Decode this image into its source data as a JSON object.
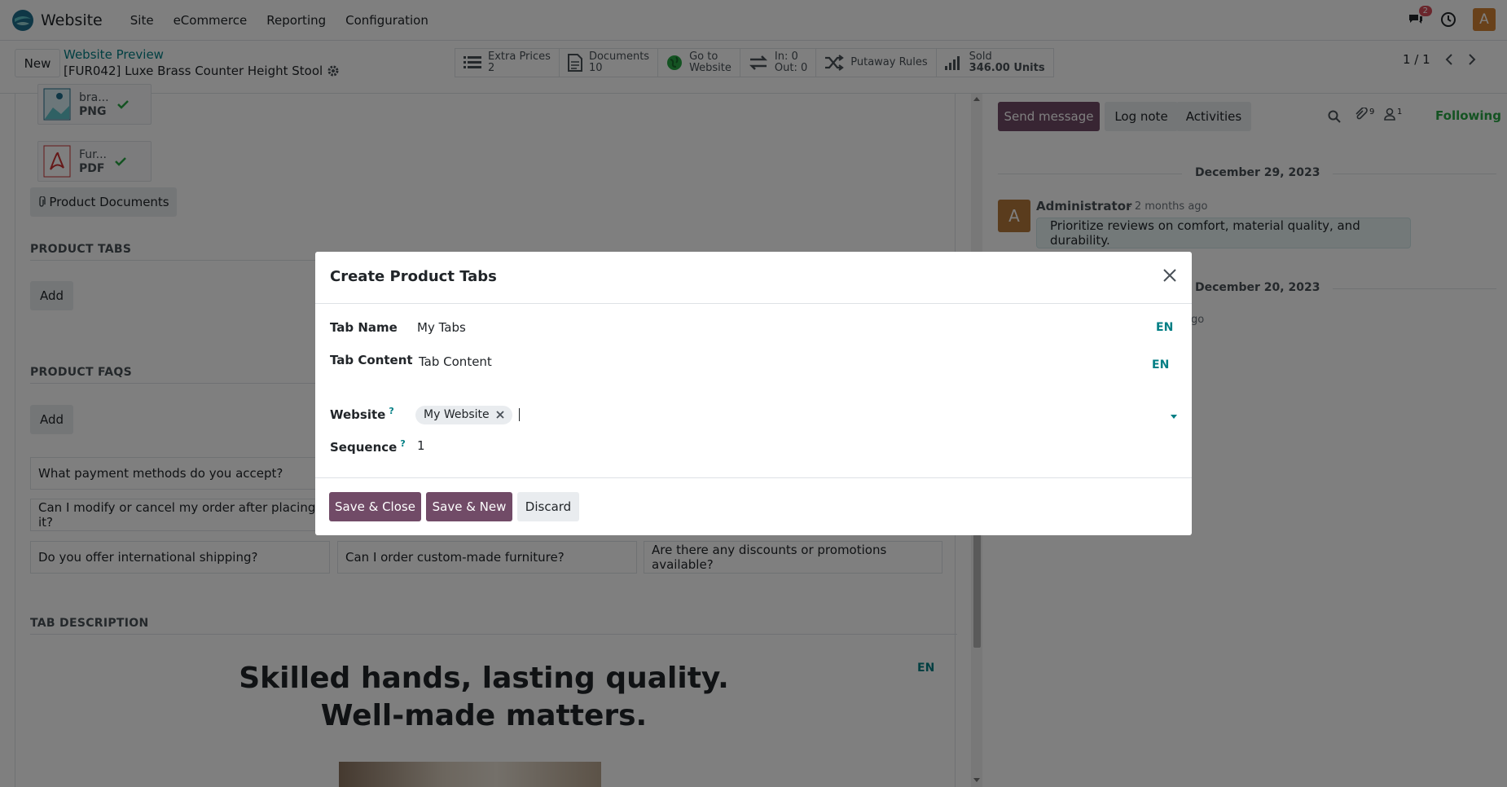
{
  "navbar": {
    "app_name": "Website",
    "menu": [
      "Site",
      "eCommerce",
      "Reporting",
      "Configuration"
    ],
    "messages_badge": "2",
    "avatar_letter": "A"
  },
  "control_panel": {
    "new_label": "New",
    "breadcrumb_link": "Website Preview",
    "record_title": "[FUR042] Luxe Brass Counter Height Stool",
    "stats": [
      {
        "icon": "list-icon",
        "line1": "Extra Prices",
        "line2": "2"
      },
      {
        "icon": "document-icon",
        "line1": "Documents",
        "line2": "10"
      },
      {
        "icon": "globe-icon",
        "line1": "Go to",
        "line2": "Website"
      },
      {
        "icon": "transfer-icon",
        "line1": "In: 0",
        "line2": "Out: 0"
      },
      {
        "icon": "shuffle-icon",
        "line1": "Putaway Rules",
        "line2": ""
      },
      {
        "icon": "signal-icon",
        "line1": "Sold",
        "line2": "346.00 Units"
      }
    ],
    "pager": "1 / 1"
  },
  "form": {
    "attachments": [
      {
        "name": "bra...",
        "ext": "PNG"
      },
      {
        "name": "Fur...",
        "ext": "PDF"
      }
    ],
    "product_documents_label": "Product Documents",
    "product_tabs_heading": "PRODUCT TABS",
    "add_label": "Add",
    "product_faqs_heading": "PRODUCT FAQS",
    "faqs": [
      "What payment methods do you accept?",
      "Can I modify or cancel my order after placing it?",
      "Do you offer international shipping?",
      "Can I order custom-made furniture?",
      "Are there any discounts or promotions available?"
    ],
    "tab_description_heading": "TAB DESCRIPTION",
    "hero_line1": "Skilled hands, lasting quality.",
    "hero_line2": "Well-made matters.",
    "lang": "EN"
  },
  "chatter": {
    "send_message": "Send message",
    "log_note": "Log note",
    "activities": "Activities",
    "attachments_count": "9",
    "followers_count": "1",
    "following": "Following",
    "date1": "December 29, 2023",
    "author": "Administrator",
    "time_ago": "- 2 months ago",
    "message": "Prioritize reviews on comfort, material quality, and durability.",
    "date2": "December 20, 2023",
    "partial_time": "go"
  },
  "modal": {
    "title": "Create Product Tabs",
    "tab_name_label": "Tab Name",
    "tab_name_value": "My Tabs",
    "tab_content_label": "Tab Content",
    "tab_content_value": "Tab Content",
    "website_label": "Website",
    "website_tag": "My Website",
    "sequence_label": "Sequence",
    "sequence_value": "1",
    "help_mark": "?",
    "lang": "EN",
    "save_close": "Save & Close",
    "save_new": "Save & New",
    "discard": "Discard"
  },
  "colors": {
    "primary": "#714b67",
    "link": "#017e84",
    "badge": "#d44c59",
    "avatar": "#d38235"
  }
}
